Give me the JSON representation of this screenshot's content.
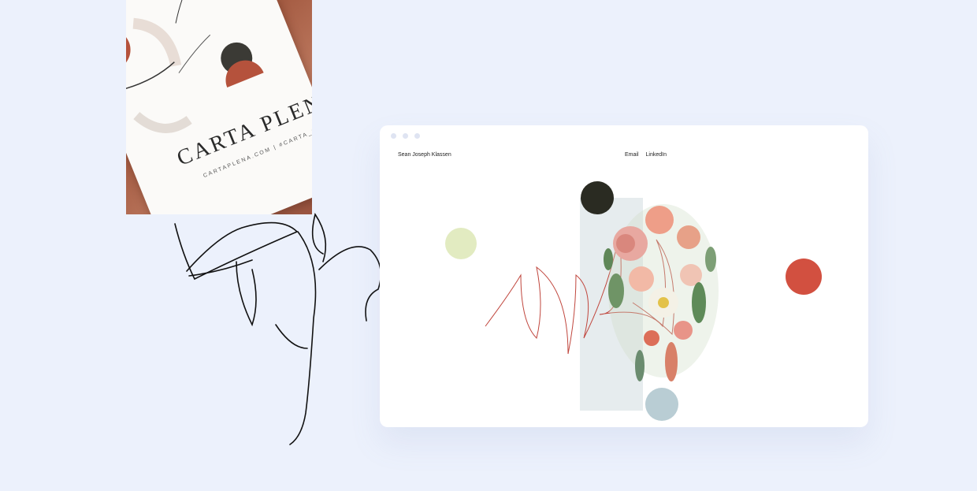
{
  "photo": {
    "card_title": "CARTA PLENA",
    "card_sub": "CARTAPLENA.COM   |   #CARTA_PLENA"
  },
  "browser": {
    "site_name": "Sean Joseph Klassen",
    "nav": [
      {
        "label": "Email"
      },
      {
        "label": "LinkedIn"
      }
    ]
  },
  "colors": {
    "background": "#ecf1fc",
    "circle_dark": "#2a2b22",
    "circle_lime": "#e2ebc1",
    "circle_red": "#d25040",
    "circle_blue": "#b9cdd4",
    "panel": "#e6ecee",
    "scribble": "#c0463d"
  }
}
